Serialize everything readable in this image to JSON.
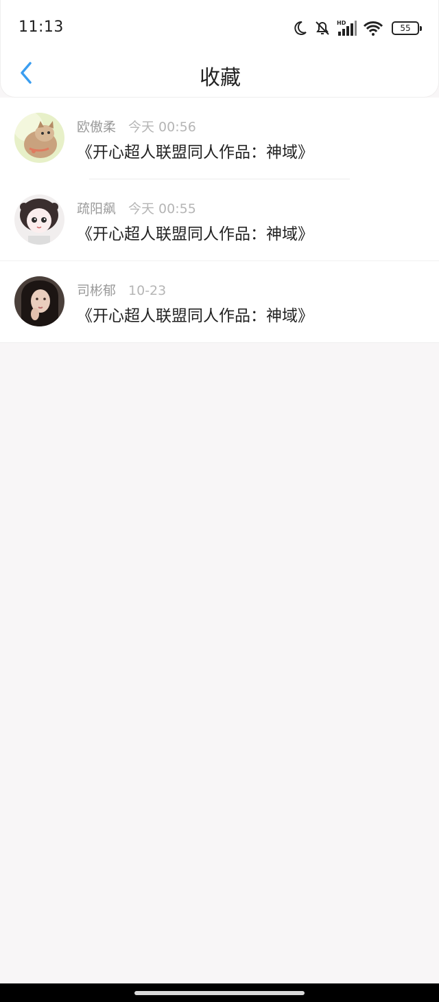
{
  "status_bar": {
    "time": "11:13",
    "battery": "55",
    "icons": [
      "moon-icon",
      "bell-off-icon",
      "signal-hd-icon",
      "wifi-icon",
      "battery-icon"
    ]
  },
  "nav": {
    "title": "收藏",
    "back_icon": "chevron-left-icon"
  },
  "favorites": [
    {
      "name": "欧傲柔",
      "time": "今天 00:56",
      "title": "《开心超人联盟同人作品：神域》",
      "avatar": "cat-avatar"
    },
    {
      "name": "疏阳飙",
      "time": "今天 00:55",
      "title": "《开心超人联盟同人作品：神域》",
      "avatar": "anime-girl-avatar"
    },
    {
      "name": "司彬郁",
      "time": "10-23",
      "title": "《开心超人联盟同人作品：神域》",
      "avatar": "woman-photo-avatar"
    }
  ],
  "colors": {
    "accent": "#3b9ef0",
    "background": "#f8f6f7"
  }
}
